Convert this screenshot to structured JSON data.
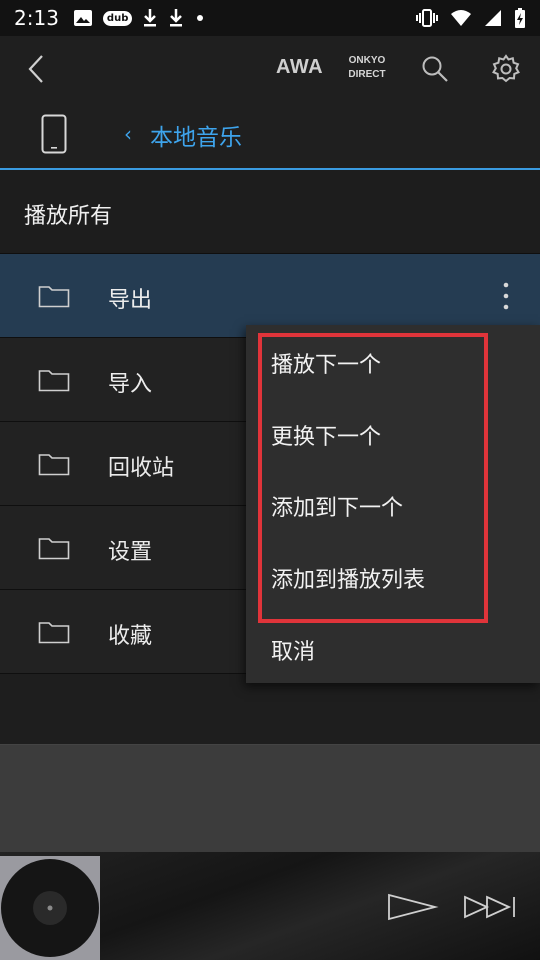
{
  "status_bar": {
    "time": "2:13",
    "dub_label": "dub",
    "left_icons": [
      "image-icon",
      "dub-icon",
      "download-icon",
      "download-icon",
      "dot-icon"
    ],
    "right_icons": [
      "vibrate-icon",
      "wifi-icon",
      "signal-icon",
      "battery-charging-icon"
    ]
  },
  "app_bar": {
    "back_icon": "chevron-left-icon",
    "awa_label": "AWA",
    "onkyo_line1": "ONKYO",
    "onkyo_line2": "DIRECT",
    "search_icon": "search-icon",
    "settings_icon": "gear-icon"
  },
  "path_bar": {
    "device_icon": "phone-icon",
    "chevron": "‹",
    "title": "本地音乐",
    "accent_color": "#3ea4ec"
  },
  "play_all": {
    "label": "播放所有"
  },
  "folders": [
    {
      "label": "导出",
      "selected": true
    },
    {
      "label": "导入",
      "selected": false
    },
    {
      "label": "回收站",
      "selected": false
    },
    {
      "label": "设置",
      "selected": false
    },
    {
      "label": "收藏",
      "selected": false
    }
  ],
  "popup_menu": {
    "items": [
      "播放下一个",
      "更换下一个",
      "添加到下一个",
      "添加到播放列表",
      "取消"
    ],
    "highlight_color": "#e0343a"
  },
  "player": {
    "album_art_icon": "vinyl-record-icon",
    "play_icon": "play-icon",
    "next_icon": "skip-next-icon"
  }
}
